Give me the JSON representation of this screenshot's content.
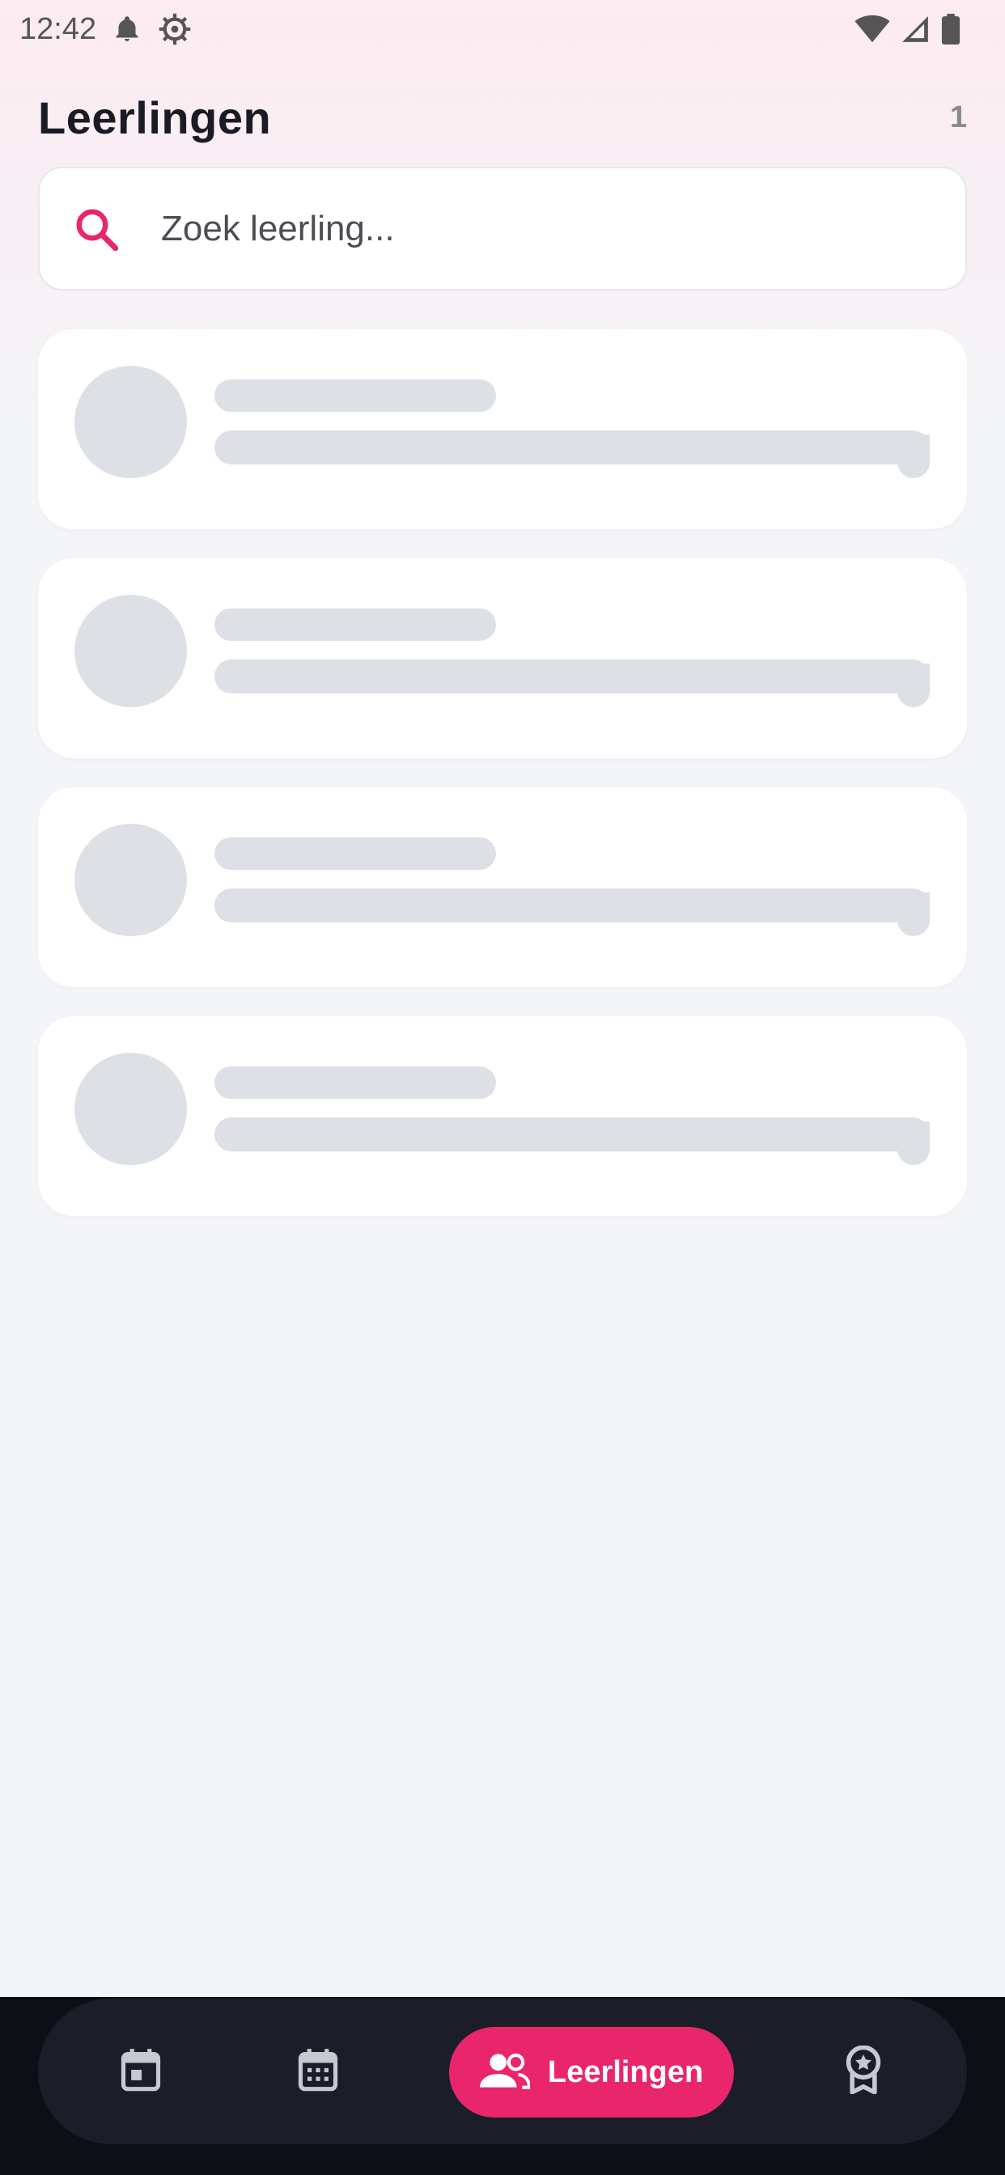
{
  "status_bar": {
    "time": "12:42",
    "icons": [
      "notification-bell-icon",
      "settings-gear-icon",
      "wifi-icon",
      "signal-icon",
      "battery-icon"
    ]
  },
  "header": {
    "title": "Leerlingen",
    "count": "1"
  },
  "search": {
    "placeholder": "Zoek leerling...",
    "value": "",
    "icon": "search-icon"
  },
  "list": {
    "state": "loading",
    "skeleton_cards": 4
  },
  "bottom_nav": {
    "items": [
      {
        "icon": "calendar-day-icon",
        "label": "",
        "active": false
      },
      {
        "icon": "calendar-month-icon",
        "label": "",
        "active": false
      },
      {
        "icon": "students-icon",
        "label": "Leerlingen",
        "active": true
      },
      {
        "icon": "award-badge-icon",
        "label": "",
        "active": false
      }
    ]
  },
  "colors": {
    "accent": "#e9266b",
    "background": "#f4f5f8",
    "nav_background": "#1b1e29",
    "skeleton": "#dde0e5",
    "title": "#1a1c25"
  }
}
